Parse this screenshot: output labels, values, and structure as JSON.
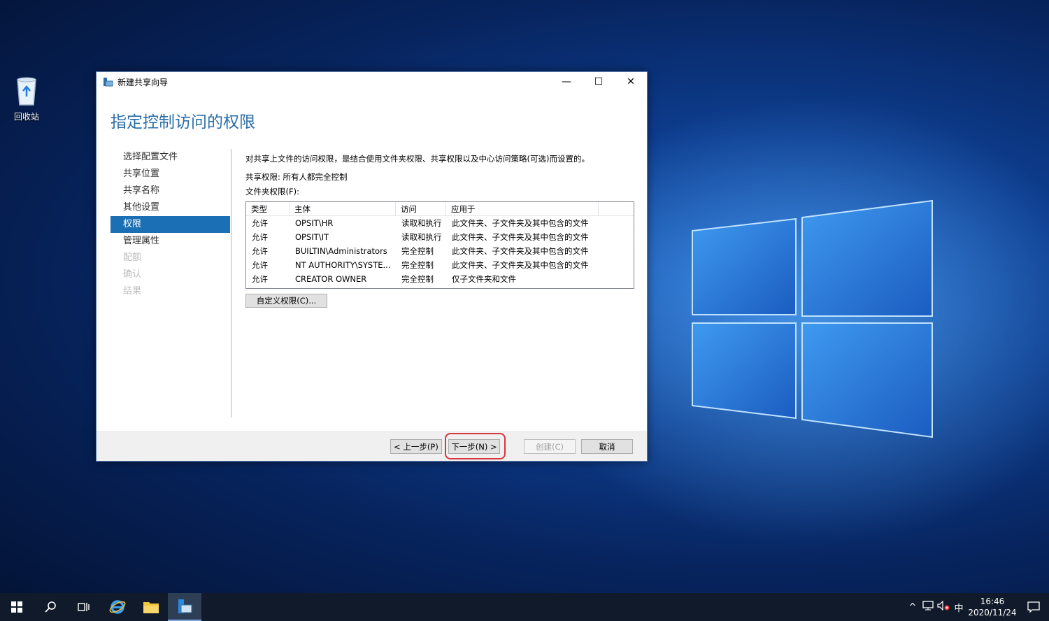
{
  "desktop": {
    "recycle_bin_label": "回收站"
  },
  "window": {
    "title": "新建共享向导",
    "heading": "指定控制访问的权限",
    "controls": {
      "minimize": "—",
      "maximize": "☐",
      "close": "✕"
    }
  },
  "nav": {
    "items": [
      {
        "label": "选择配置文件",
        "state": "normal"
      },
      {
        "label": "共享位置",
        "state": "normal"
      },
      {
        "label": "共享名称",
        "state": "normal"
      },
      {
        "label": "其他设置",
        "state": "normal"
      },
      {
        "label": "权限",
        "state": "active"
      },
      {
        "label": "管理属性",
        "state": "normal"
      },
      {
        "label": "配额",
        "state": "disabled"
      },
      {
        "label": "确认",
        "state": "disabled"
      },
      {
        "label": "结果",
        "state": "disabled"
      }
    ]
  },
  "content": {
    "description": "对共享上文件的访问权限，是结合使用文件夹权限、共享权限以及中心访问策略(可选)而设置的。",
    "share_permissions": "共享权限: 所有人都完全控制",
    "folder_permissions_label": "文件夹权限(F):",
    "table": {
      "columns": [
        "类型",
        "主体",
        "访问",
        "应用于"
      ],
      "rows": [
        [
          "允许",
          "OPSIT\\HR",
          "读取和执行",
          "此文件夹、子文件夹及其中包含的文件"
        ],
        [
          "允许",
          "OPSIT\\IT",
          "读取和执行",
          "此文件夹、子文件夹及其中包含的文件"
        ],
        [
          "允许",
          "BUILTIN\\Administrators",
          "完全控制",
          "此文件夹、子文件夹及其中包含的文件"
        ],
        [
          "允许",
          "NT AUTHORITY\\SYSTE...",
          "完全控制",
          "此文件夹、子文件夹及其中包含的文件"
        ],
        [
          "允许",
          "CREATOR OWNER",
          "完全控制",
          "仅子文件夹和文件"
        ]
      ]
    },
    "custom_button": "自定义权限(C)..."
  },
  "footer": {
    "prev": "< 上一步(P)",
    "next": "下一步(N) >",
    "create": "创建(C)",
    "cancel": "取消"
  },
  "taskbar": {
    "tray_lang": "中",
    "time": "16:46",
    "date": "2020/11/24"
  },
  "colors": {
    "accent": "#1a6fb5",
    "heading": "#2b6fa8",
    "highlight": "#d9363e",
    "taskbar": "#101a2a"
  }
}
